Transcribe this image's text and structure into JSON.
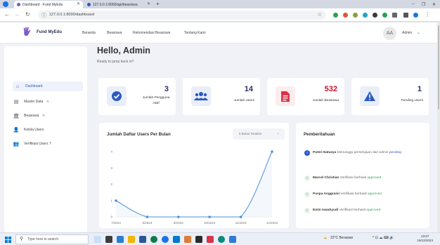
{
  "browser": {
    "tabs": [
      {
        "label": "Dashboard - Fund MyEdu",
        "active": true
      },
      {
        "label": "127.0.0.1:8000/api/beasiswa",
        "active": false
      }
    ],
    "url": "127.0.0.1:8000/dashboard",
    "new_tab_glyph": "+",
    "window_controls": [
      "–",
      "❐",
      "✕"
    ]
  },
  "nav": {
    "brand": "Fund MyEdu",
    "links": [
      "Beranda",
      "Beasiswa",
      "Rekomendasi Beasiswa",
      "Tentang Kami"
    ],
    "avatar_initials": "AA",
    "user": "Admin",
    "caret": "⌄"
  },
  "sidebar": {
    "items": [
      {
        "label": "Dashboard",
        "icon": "home-icon",
        "glyph": "⌂",
        "active": true
      },
      {
        "label": "Master Data",
        "icon": "table-icon",
        "glyph": "▤",
        "chevron": "»"
      },
      {
        "label": "Beasiswa",
        "icon": "bank-icon",
        "glyph": "🏛",
        "chevron": "»"
      },
      {
        "label": "Kelola Users",
        "icon": "user-icon",
        "glyph": "👤"
      },
      {
        "label": "Verifikasi Users 7",
        "icon": "user-check-icon",
        "glyph": "👥"
      }
    ]
  },
  "main": {
    "greeting": "Hello, Admin",
    "subtitle": "Ready to jump back in?"
  },
  "stats": [
    {
      "value": "3",
      "label": "Jumlah Pengguna Aktif",
      "icon": "check-circle-icon",
      "color": "#2b59c3"
    },
    {
      "value": "14",
      "label": "Jumlah Users",
      "icon": "users-icon",
      "color": "#2b59c3"
    },
    {
      "value": "532",
      "label": "Jumlah Beasiswa",
      "icon": "document-icon",
      "color": "#d9344a"
    },
    {
      "value": "1",
      "label": "Pending Users",
      "icon": "warning-icon",
      "color": "#2b59c3"
    }
  ],
  "chart": {
    "heading": "Jumlah Daftar Users Per Bulan",
    "select_value": "6 Bulan Terakhir",
    "select_caret": "⌄"
  },
  "chart_data": {
    "type": "line",
    "categories": [
      "7/2023",
      "8/2023",
      "9/2023",
      "10/2023",
      "11/2023",
      "12/2023"
    ],
    "values": [
      1,
      0,
      0,
      0,
      0,
      4
    ],
    "ylim": [
      0,
      4
    ],
    "y_ticks": [
      "0",
      "1",
      "2",
      "3",
      "4"
    ],
    "color": "#4a90d9",
    "grid": false,
    "title": "",
    "xlabel": "",
    "ylabel": ""
  },
  "notifications": {
    "title": "Pemberitahuan",
    "items": [
      {
        "name": "Puteri Natasya",
        "text": "Menunggu persetujuan dari admin",
        "status": "pending",
        "type": "info"
      },
      {
        "name": "Marcel Christian",
        "text": "Verifikasi berhasil",
        "status": "approved",
        "type": "success"
      },
      {
        "name": "Puspa Anggraini",
        "text": "Verifikasi berhasil",
        "status": "approved",
        "type": "success"
      },
      {
        "name": "Emin Iswahyudi",
        "text": "Verifikasi berhasil",
        "status": "approved",
        "type": "success"
      }
    ]
  },
  "taskbar": {
    "search_placeholder": "Type here to search",
    "weather": "22°C Berawan",
    "time": "23:07",
    "date": "19/12/2023"
  }
}
